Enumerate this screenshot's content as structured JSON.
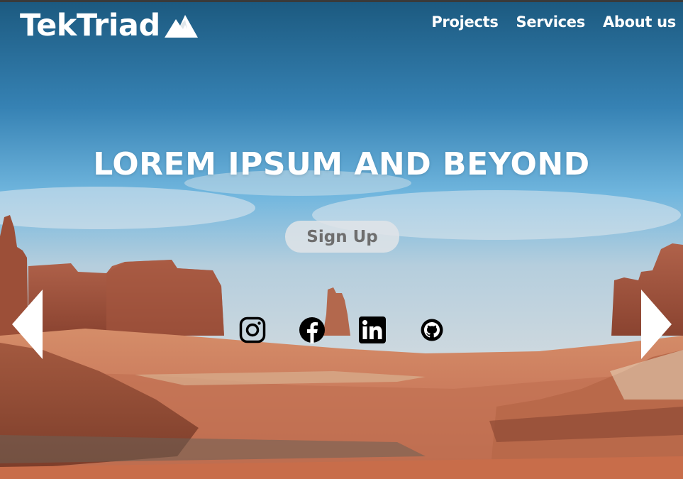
{
  "brand": {
    "name": "TekTriad",
    "icon": "mountain-icon"
  },
  "nav": {
    "items": [
      {
        "label": "Projects"
      },
      {
        "label": "Services"
      },
      {
        "label": "About us"
      }
    ]
  },
  "hero": {
    "headline": "LOREM IPSUM AND BEYOND",
    "cta_label": "Sign Up",
    "carousel": {
      "prev_icon": "chevron-left-icon",
      "next_icon": "chevron-right-icon"
    }
  },
  "social": [
    {
      "name": "Instagram",
      "icon": "instagram-icon"
    },
    {
      "name": "Facebook",
      "icon": "facebook-icon"
    },
    {
      "name": "LinkedIn",
      "icon": "linkedin-icon"
    },
    {
      "name": "GitHub",
      "icon": "github-icon"
    }
  ],
  "colors": {
    "text": "#ffffff",
    "button_bg": "#e1e4e8",
    "button_text": "#6e6e6e",
    "icon": "#000000"
  }
}
